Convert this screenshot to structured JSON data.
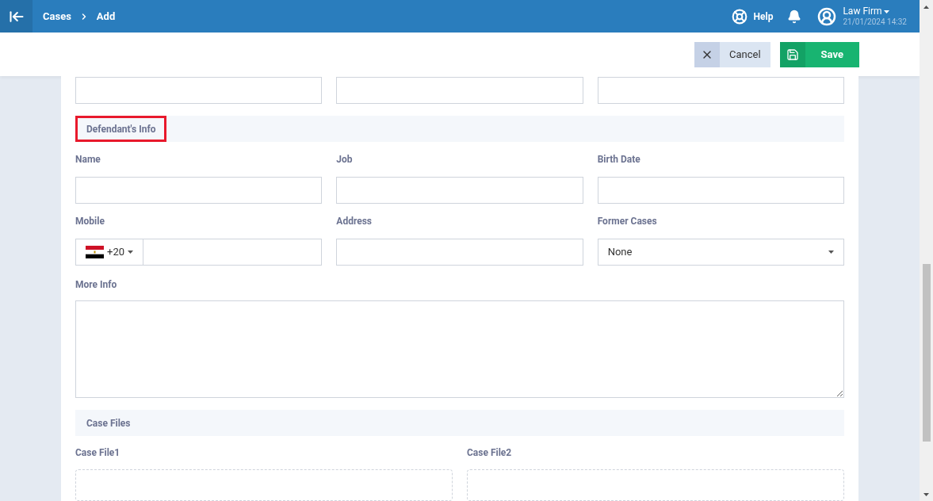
{
  "topbar": {
    "breadcrumb": [
      "Cases",
      "Add"
    ],
    "help": "Help",
    "user": {
      "name": "Law Firm",
      "datetime": "21/01/2024 14:32"
    }
  },
  "toolbar": {
    "cancel": "Cancel",
    "save": "Save"
  },
  "top_row_fields": [
    {
      "kind": "text"
    },
    {
      "kind": "text"
    },
    {
      "kind": "text"
    }
  ],
  "defendant": {
    "title": "Defendant's Info",
    "highlighted": true,
    "fields": [
      {
        "kind": "text",
        "label": "Name"
      },
      {
        "kind": "text",
        "label": "Job"
      },
      {
        "kind": "text",
        "label": "Birth Date"
      },
      {
        "kind": "phone",
        "label": "Mobile",
        "code": "+20"
      },
      {
        "kind": "text",
        "label": "Address"
      },
      {
        "kind": "select",
        "label": "Former Cases",
        "value": "None"
      }
    ],
    "more_info": {
      "label": "More Info"
    }
  },
  "case_files": {
    "title": "Case Files",
    "highlighted": false,
    "files": [
      {
        "label": "Case File1"
      },
      {
        "label": "Case File2"
      }
    ]
  }
}
